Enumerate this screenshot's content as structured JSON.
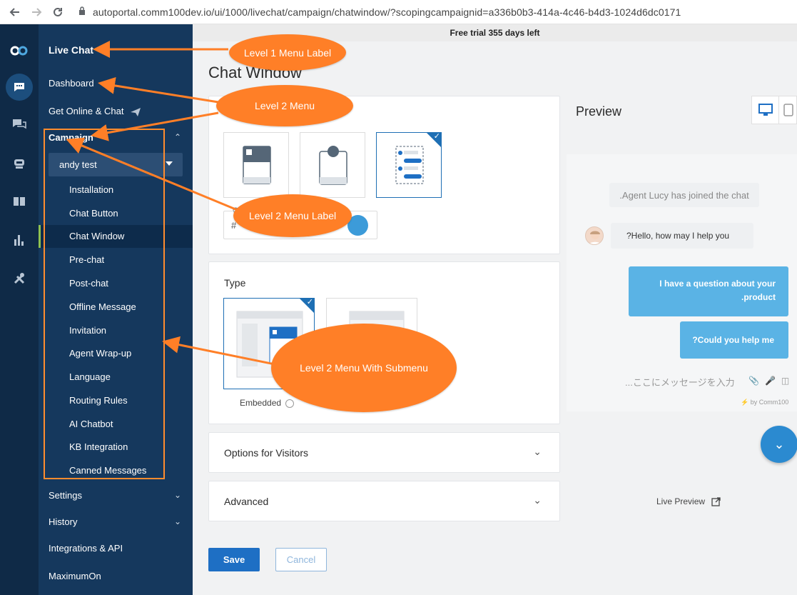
{
  "browser": {
    "url": "autoportal.comm100dev.io/ui/1000/livechat/campaign/chatwindow/?scopingcampaignid=a336b0b3-414a-4c46-b4d3-1024d6dc0171",
    "back_icon": "arrow-left-icon",
    "forward_icon": "arrow-right-icon",
    "reload_icon": "reload-icon",
    "lock_icon": "lock-icon"
  },
  "icon_rail": {
    "items": [
      {
        "name": "logo",
        "icon": "comm100-logo"
      },
      {
        "name": "live-chat",
        "icon": "chat-bubble-icon",
        "active": true
      },
      {
        "name": "ticket",
        "icon": "messages-icon"
      },
      {
        "name": "bot",
        "icon": "bot-icon"
      },
      {
        "name": "knowledge-base",
        "icon": "book-icon"
      },
      {
        "name": "reports",
        "icon": "bar-chart-icon"
      },
      {
        "name": "settings",
        "icon": "tools-icon"
      }
    ]
  },
  "sidebar": {
    "title": "Live Chat",
    "items": [
      {
        "label": "Dashboard"
      },
      {
        "label": "Get Online & Chat"
      },
      {
        "label": "Campaign"
      }
    ],
    "campaign_select": "andy test",
    "sub_items": [
      {
        "label": "Installation"
      },
      {
        "label": "Chat Button"
      },
      {
        "label": "Chat Window",
        "active": true
      },
      {
        "label": "Pre-chat"
      },
      {
        "label": "Post-chat"
      },
      {
        "label": "Offline Message"
      },
      {
        "label": "Invitation"
      },
      {
        "label": "Agent Wrap-up"
      },
      {
        "label": "Language"
      },
      {
        "label": "Routing Rules"
      },
      {
        "label": "AI Chatbot"
      },
      {
        "label": "KB Integration"
      },
      {
        "label": "Canned Messages"
      }
    ],
    "bottom_items": [
      {
        "label": "Settings"
      },
      {
        "label": "History"
      },
      {
        "label": "Integrations & API"
      },
      {
        "label": "MaximumOn"
      }
    ]
  },
  "main": {
    "trial": "Free trial 355 days left",
    "title": "Chat Window",
    "color_label": "C",
    "color_hash": "#",
    "type_title": "Type",
    "type_option": "Embedded",
    "options_title": "Options for Visitors",
    "advanced_title": "Advanced",
    "save": "Save",
    "cancel": "Cancel"
  },
  "preview": {
    "title": "Preview",
    "system_msg": ".Agent Lucy has joined the chat",
    "agent_msg": "?Hello, how may I help you",
    "visitor_msg1": "I have a question about your .product",
    "visitor_msg2": "?Could you help me",
    "input_placeholder": "...ここにメッセージを入力",
    "powered_by": "by Comm100",
    "live_preview": "Live Preview"
  },
  "annotations": {
    "level1_label": "Level 1 Menu Label",
    "level2_menu": "Level 2 Menu",
    "level2_label": "Level 2 Menu Label",
    "level2_submenu": "Level 2 Menu With Submenu"
  },
  "colors": {
    "rail": "#0f2a47",
    "sidebar": "#15385d",
    "accent": "#1e6fc4",
    "callout": "#ff7f27",
    "bubble": "#5ab3e5"
  }
}
